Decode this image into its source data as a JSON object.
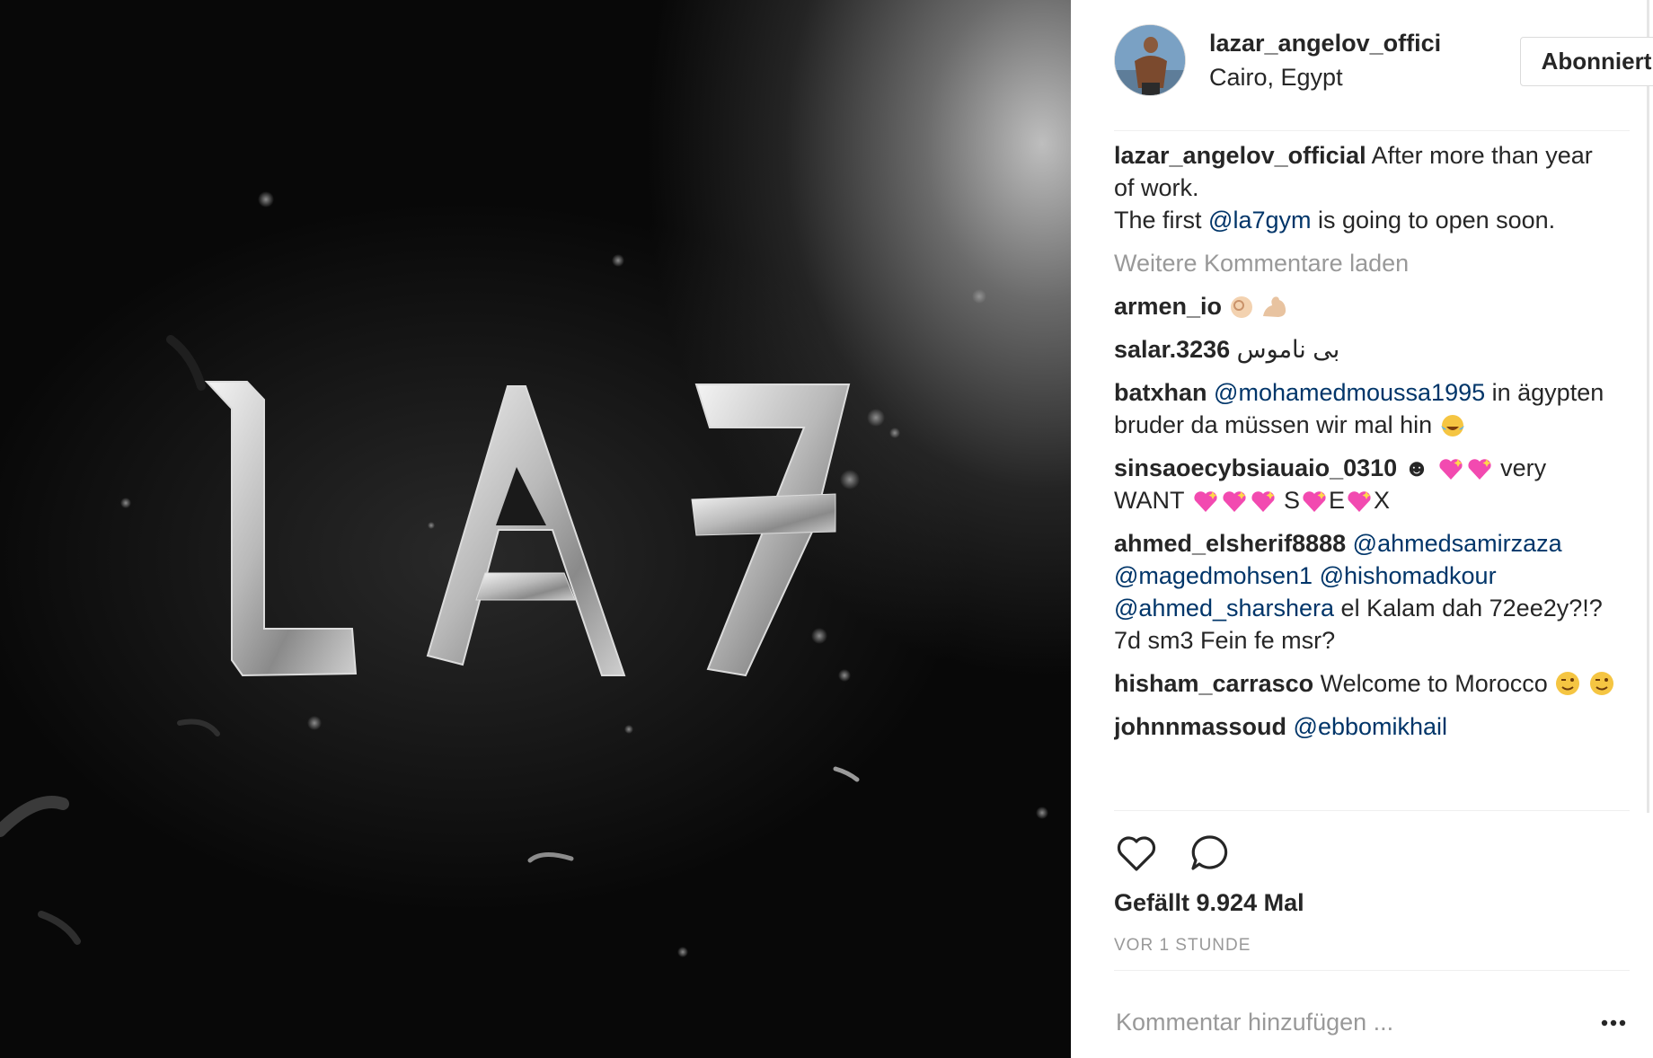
{
  "image": {
    "logo_text": "LA7"
  },
  "header": {
    "username": "lazar_angelov_offici",
    "location": "Cairo, Egypt",
    "follow_label": "Abonniert"
  },
  "caption": {
    "user": "lazar_angelov_official",
    "text_1": " After more than year of work.",
    "text_2": "The first ",
    "mention": "@la7gym",
    "text_3": " is going to open soon."
  },
  "load_more": "Weitere Kommentare laden",
  "comments": [
    {
      "user": "armen_io",
      "text": " "
    },
    {
      "user": "salar.3236",
      "text": " بی ناموس"
    },
    {
      "user": "batxhan",
      "mention": "@mohamedmoussa1995",
      "text": " in ägypten bruder da müssen wir mal hin "
    },
    {
      "user": "sinsaoecybsiauaio_0310",
      "text_a": " ☻ ",
      "text_b": "  very WANT ",
      "text_c": "  S",
      "text_d": "E",
      "text_e": "X"
    },
    {
      "user": "ahmed_elsherif8888",
      "mention_1": "@ahmedsamirzaza",
      "mention_2": "@magedmohsen1",
      "mention_3": "@hishomadkour",
      "mention_4": "@ahmed_sharshera",
      "text": " el Kalam dah 72ee2y?!? 7d sm3 Fein fe msr?"
    },
    {
      "user": "hisham_carrasco",
      "text": " Welcome to Morocco"
    },
    {
      "user": "johnnmassoud",
      "mention": "@ebbomikhail"
    }
  ],
  "likes": "Gefällt 9.924 Mal",
  "time": "VOR 1 STUNDE",
  "comment_input": {
    "placeholder": "Kommentar hinzufügen ..."
  },
  "icons": {
    "like": "heart-icon",
    "comment": "comment-bubble-icon",
    "more": "more-options-icon"
  },
  "colors": {
    "mention": "#003569",
    "muted": "#999999",
    "text": "#262626",
    "border": "#dbdbdb"
  }
}
